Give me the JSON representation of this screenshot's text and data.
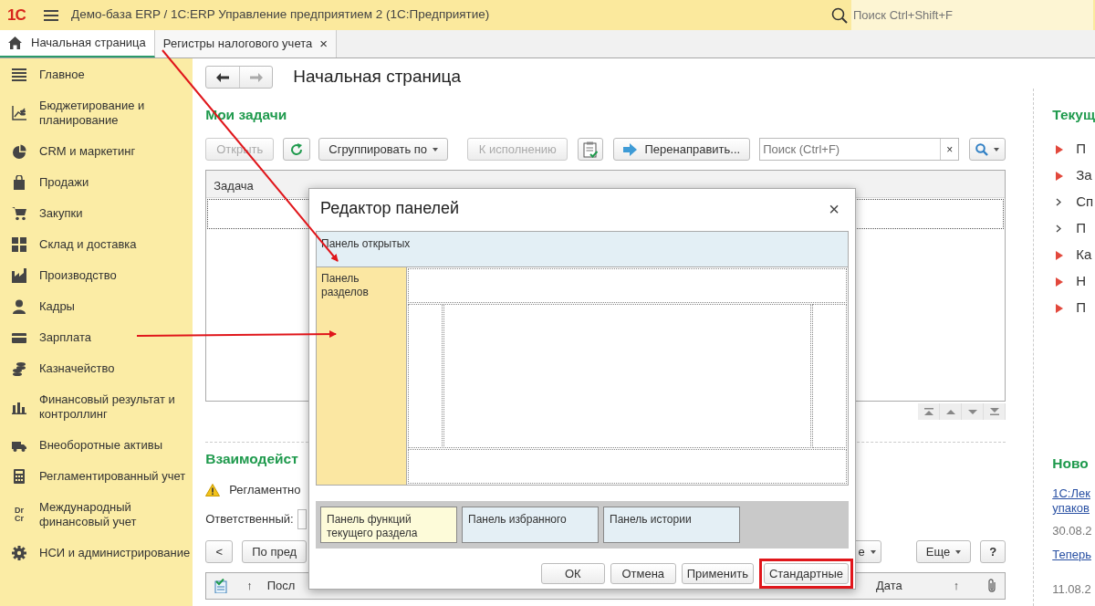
{
  "app_bar": {
    "logo": "1С",
    "title": "Демо-база ERP / 1С:ERP Управление предприятием 2  (1С:Предприятие)",
    "search": {
      "placeholder": "Поиск Ctrl+Shift+F"
    }
  },
  "tabs": [
    {
      "label": "Начальная страница",
      "selected": true,
      "kind": "home"
    },
    {
      "label": "Регистры налогового учета",
      "selected": false,
      "kind": "closable",
      "close": "×"
    }
  ],
  "sidebar": {
    "items": [
      {
        "label": "Главное",
        "kind": "list"
      },
      {
        "label": "Бюджетирование и планирование",
        "kind": "budget"
      },
      {
        "label": "CRM и маркетинг",
        "kind": "crm"
      },
      {
        "label": "Продажи",
        "kind": "sales"
      },
      {
        "label": "Закупки",
        "kind": "purchases"
      },
      {
        "label": "Склад и доставка",
        "kind": "warehouse"
      },
      {
        "label": "Производство",
        "kind": "production"
      },
      {
        "label": "Кадры",
        "kind": "staff"
      },
      {
        "label": "Зарплата",
        "kind": "salary"
      },
      {
        "label": "Казначейство",
        "kind": "treasury"
      },
      {
        "label": "Финансовый результат и контроллинг",
        "kind": "finance"
      },
      {
        "label": "Внеоборотные активы",
        "kind": "assets"
      },
      {
        "label": "Регламентированный учет",
        "kind": "regulated"
      },
      {
        "label": "Международный финансовый учет",
        "kind": "text",
        "icon_text": [
          "Dr",
          "Cr"
        ]
      },
      {
        "label": "НСИ и администрирование",
        "kind": "admin"
      }
    ]
  },
  "page": {
    "title": "Начальная страница"
  },
  "tasks": {
    "title": "Мои задачи",
    "toolbar": {
      "open": {
        "label": "Открыть",
        "disabled": true
      },
      "group_by": {
        "label": "Сгруппировать по"
      },
      "execute": {
        "label": "К исполнению",
        "disabled": true
      },
      "redirect": {
        "label": "Перенаправить..."
      },
      "search": {
        "placeholder": "Поиск (Ctrl+F)",
        "clear": "×"
      }
    },
    "table": {
      "columns": [
        "Задача"
      ]
    }
  },
  "interactions": {
    "title": "Взаимодейст",
    "warning": "Регламентно",
    "responsible_label": "Ответственный:",
    "back": "<",
    "filter": "По пред",
    "partial_dropdown": "е",
    "more": "Еще",
    "help": "?",
    "columns_left": [
      "↑",
      "Посл"
    ],
    "columns_right": [
      "Дата",
      "↑"
    ]
  },
  "current": {
    "title": "Текущ",
    "items": [
      {
        "label": "П",
        "kind": "important"
      },
      {
        "label": "За",
        "kind": "important"
      },
      {
        "label": "Сп",
        "kind": "normal"
      },
      {
        "label": "П",
        "kind": "normal"
      },
      {
        "label": "Ка",
        "kind": "important"
      },
      {
        "label": "Н",
        "kind": "important"
      },
      {
        "label": "П",
        "kind": "important"
      }
    ]
  },
  "news": {
    "title": "Ново",
    "items": [
      {
        "link_lines": [
          "1С:Лек",
          "упаков"
        ],
        "date": "30.08.2"
      },
      {
        "link_lines": [
          "Теперь"
        ],
        "date": "11.08.2"
      }
    ]
  },
  "dialog": {
    "title": "Редактор панелей",
    "close": "×",
    "open_panel": "Панель открытых",
    "sections_panel": "Панель разделов",
    "bottom_panels": [
      {
        "label": "Панель функций текущего раздела",
        "kind": "functions"
      },
      {
        "label": "Панель избранного",
        "kind": "favorites"
      },
      {
        "label": "Панель истории",
        "kind": "history"
      }
    ],
    "buttons": [
      {
        "label": "ОК",
        "highlighted": false
      },
      {
        "label": "Отмена",
        "highlighted": false
      },
      {
        "label": "Применить",
        "highlighted": false
      },
      {
        "label": "Стандартные",
        "highlighted": true
      }
    ]
  }
}
